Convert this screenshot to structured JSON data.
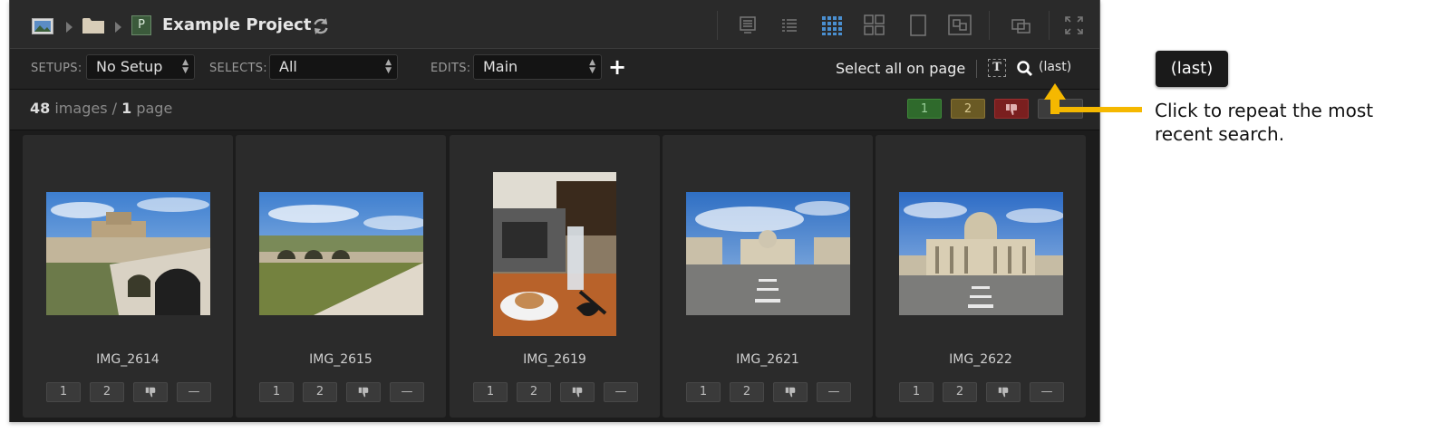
{
  "header": {
    "project_badge": "P",
    "project_title": "Example Project"
  },
  "toolbar": {
    "setups_label": "SETUPS:",
    "setups_value": "No Setup",
    "selects_label": "SELECTS:",
    "selects_value": "All",
    "edits_label": "EDITS:",
    "edits_value": "Main",
    "add_label": "+",
    "select_all_label": "Select all on page",
    "search_last_label": "(last)"
  },
  "counts": {
    "images": "48",
    "images_label": "images /",
    "pages": "1",
    "pages_label": "page"
  },
  "filters": [
    "1",
    "2"
  ],
  "images": [
    {
      "name": "IMG_2614",
      "scene": "castle-bridge"
    },
    {
      "name": "IMG_2615",
      "scene": "river-bridge"
    },
    {
      "name": "IMG_2619",
      "scene": "cafe"
    },
    {
      "name": "IMG_2621",
      "scene": "piazza"
    },
    {
      "name": "IMG_2622",
      "scene": "basilica"
    }
  ],
  "rating_buttons": [
    "1",
    "2",
    "—"
  ],
  "annotation": {
    "bubble": "(last)",
    "text": "Click to repeat the most recent search."
  },
  "colors": {
    "arrow": "#f5b800",
    "filter_green": "#2f6a2c",
    "filter_yellow": "#6a5a24",
    "filter_red": "#7a1f1f",
    "accent_blue": "#4a8fd0"
  }
}
